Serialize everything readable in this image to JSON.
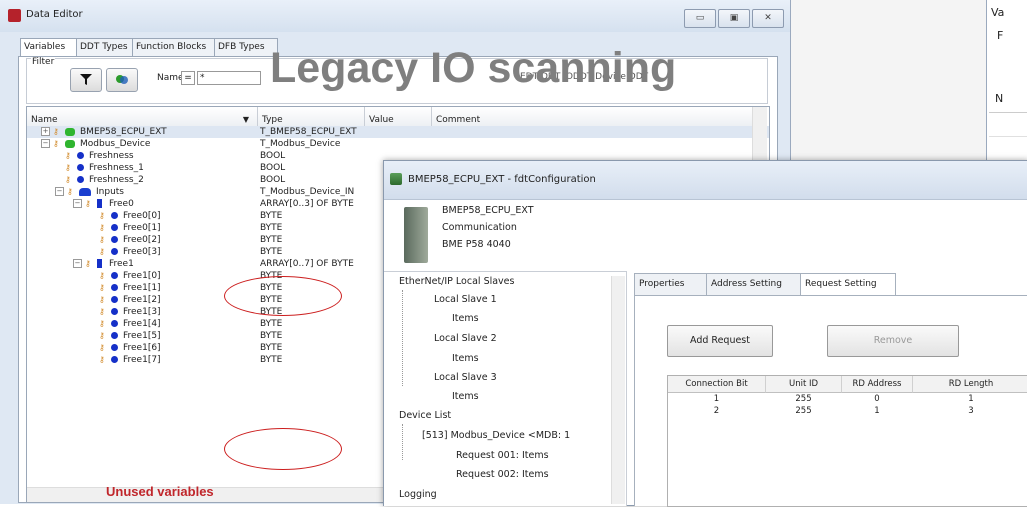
{
  "data_editor": {
    "title": "Data Editor",
    "window_buttons": [
      "▭",
      "▣",
      "✕"
    ],
    "tabs": [
      "Variables",
      "DDT Types",
      "Function Blocks",
      "DFB Types"
    ],
    "filter_label": "Filter",
    "name_label": "Name",
    "name_equals": "=",
    "name_value": "*",
    "filter_options": "EDT   DDT   IODDT   Device DDT",
    "columns": [
      "Name",
      "Type",
      "Value",
      "Comment"
    ],
    "rows": [
      {
        "name": "BMEP58_ECPU_EXT",
        "type": "T_BMEP58_ECPU_EXT",
        "icon": "device"
      },
      {
        "name": "Modbus_Device",
        "type": "T_Modbus_Device",
        "icon": "device"
      },
      {
        "name": "Freshness",
        "type": "BOOL",
        "icon": "dot"
      },
      {
        "name": "Freshness_1",
        "type": "BOOL",
        "icon": "dot"
      },
      {
        "name": "Freshness_2",
        "type": "BOOL",
        "icon": "dot"
      },
      {
        "name": "Inputs",
        "type": "T_Modbus_Device_IN",
        "icon": "folder"
      },
      {
        "name": "Free0",
        "type": "ARRAY[0..3] OF BYTE",
        "icon": "bar"
      },
      {
        "name": "Free0[0]",
        "type": "BYTE",
        "icon": "dot"
      },
      {
        "name": "Free0[1]",
        "type": "BYTE",
        "icon": "dot"
      },
      {
        "name": "Free0[2]",
        "type": "BYTE",
        "icon": "dot"
      },
      {
        "name": "Free0[3]",
        "type": "BYTE",
        "icon": "dot"
      },
      {
        "name": "Free1",
        "type": "ARRAY[0..7] OF BYTE",
        "icon": "bar"
      },
      {
        "name": "Free1[0]",
        "type": "BYTE",
        "icon": "dot"
      },
      {
        "name": "Free1[1]",
        "type": "BYTE",
        "icon": "dot"
      },
      {
        "name": "Free1[2]",
        "type": "BYTE",
        "icon": "dot"
      },
      {
        "name": "Free1[3]",
        "type": "BYTE",
        "icon": "dot"
      },
      {
        "name": "Free1[4]",
        "type": "BYTE",
        "icon": "dot"
      },
      {
        "name": "Free1[5]",
        "type": "BYTE",
        "icon": "dot"
      },
      {
        "name": "Free1[6]",
        "type": "BYTE",
        "icon": "dot"
      },
      {
        "name": "Free1[7]",
        "type": "BYTE",
        "icon": "dot"
      }
    ]
  },
  "overlay": {
    "title": "Legacy IO scanning",
    "caption": "Unused variables",
    "accent_color": "#c0262b"
  },
  "right_window": {
    "line1": "Va",
    "line2": "F",
    "line3": "N"
  },
  "config": {
    "title": "BMEP58_ECPU_EXT - fdtConfiguration",
    "module_name": "BMEP58_ECPU_EXT",
    "module_kind": "Communication",
    "module_ref": "BME P58 4040",
    "tree": [
      "EtherNet/IP Local Slaves",
      "Local Slave 1",
      "Items",
      "Local Slave 2",
      "Items",
      "Local Slave 3",
      "Items",
      "Device List",
      "[513] Modbus_Device <MDB: 1",
      "Request 001: Items",
      "Request 002: Items",
      "Logging"
    ],
    "tabs": [
      "Properties",
      "Address Setting",
      "Request Setting"
    ],
    "add_button": "Add Request",
    "remove_button": "Remove",
    "table_headers": [
      "Connection Bit",
      "Unit ID",
      "RD Address",
      "RD Length"
    ],
    "table_rows": [
      [
        "1",
        "255",
        "0",
        "1"
      ],
      [
        "2",
        "255",
        "1",
        "3"
      ]
    ]
  }
}
